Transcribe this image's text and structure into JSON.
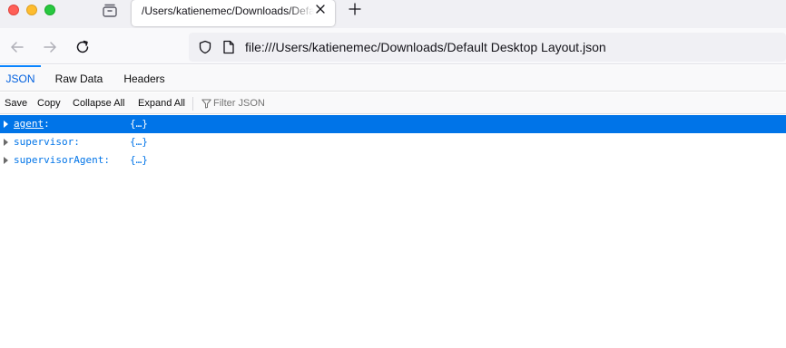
{
  "window": {
    "traffic_lights": [
      "close",
      "minimize",
      "zoom"
    ]
  },
  "tab": {
    "title": "/Users/katienemec/Downloads/Default Desktop Layout.json"
  },
  "navigation": {
    "url": "file:///Users/katienemec/Downloads/Default Desktop Layout.json"
  },
  "viewer_tabs": [
    {
      "label": "JSON",
      "active": true
    },
    {
      "label": "Raw Data",
      "active": false
    },
    {
      "label": "Headers",
      "active": false
    }
  ],
  "toolbar": {
    "save_label": "Save",
    "copy_label": "Copy",
    "collapse_label": "Collapse All",
    "expand_label": "Expand All",
    "filter_placeholder": "Filter JSON"
  },
  "tree": {
    "rows": [
      {
        "key": "agent",
        "colon": ":",
        "value": "{…}",
        "selected": true
      },
      {
        "key": "supervisor",
        "colon": ":",
        "value": "{…}",
        "selected": false
      },
      {
        "key": "supervisorAgent",
        "colon": ":",
        "value": "{…}",
        "selected": false
      }
    ]
  },
  "colors": {
    "accent": "#0074e8",
    "selected_row": "#0074e8",
    "tab_strip": "#f0f0f4",
    "traffic_red": "#ff5f57",
    "traffic_yellow": "#febc2e",
    "traffic_green": "#28c840"
  },
  "icons": {
    "tab_overview": "tab-overview-icon",
    "tab_close": "close-icon",
    "new_tab": "plus-icon",
    "back": "back-arrow-icon",
    "forward": "forward-arrow-icon",
    "reload": "reload-icon",
    "tracking_protection": "shield-icon",
    "page": "page-icon",
    "filter": "filter-icon",
    "expand": "twisty-right-icon"
  }
}
